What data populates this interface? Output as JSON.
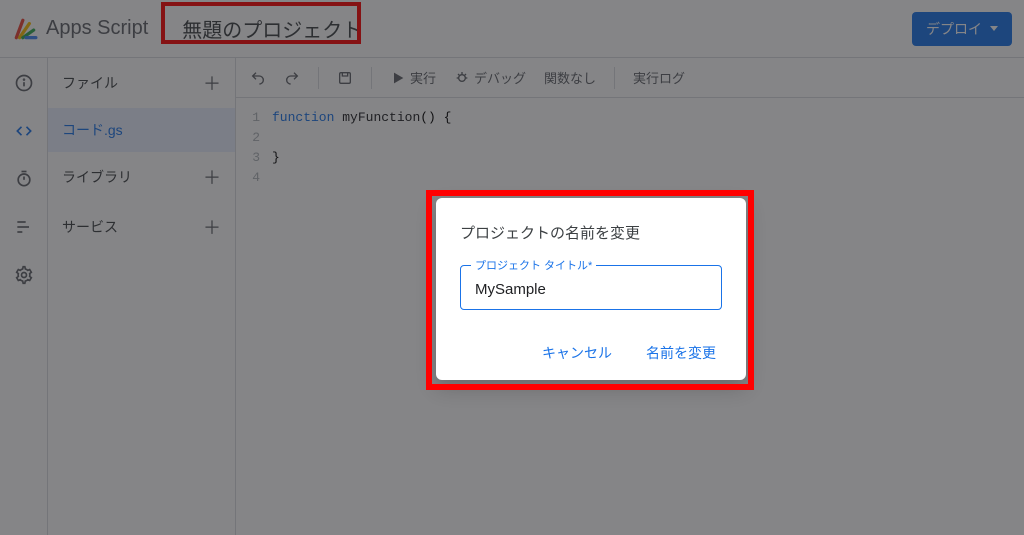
{
  "header": {
    "app_name": "Apps Script",
    "project_title": "無題のプロジェクト",
    "deploy_label": "デプロイ"
  },
  "sidebar": {
    "files_label": "ファイル",
    "libraries_label": "ライブラリ",
    "services_label": "サービス",
    "file_items": [
      {
        "name": "コード.gs"
      }
    ]
  },
  "toolbar": {
    "run_label": "実行",
    "debug_label": "デバッグ",
    "func_selector": "関数なし",
    "exec_log_label": "実行ログ"
  },
  "editor": {
    "lines": [
      "function myFunction() {",
      "",
      "}",
      ""
    ]
  },
  "dialog": {
    "title": "プロジェクトの名前を変更",
    "field_label": "プロジェクト タイトル*",
    "field_value": "MySample",
    "cancel_label": "キャンセル",
    "confirm_label": "名前を変更"
  }
}
